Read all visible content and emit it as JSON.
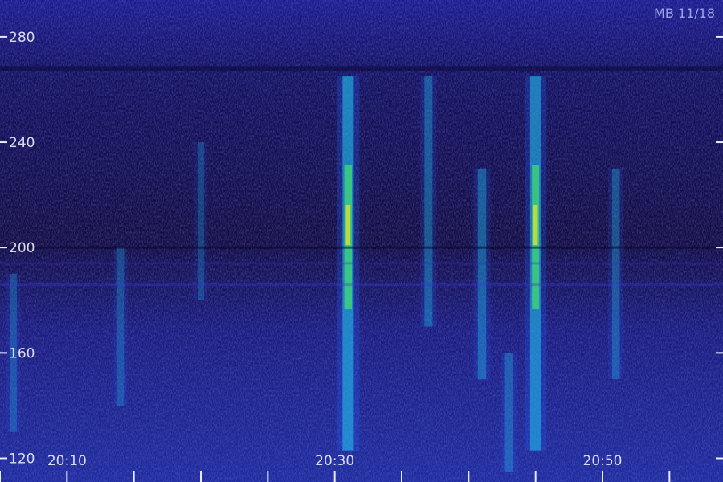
{
  "chart_data": {
    "type": "heatmap",
    "title": "",
    "xlabel": "",
    "ylabel": "",
    "watermark": "MB 11/18",
    "y_ticks": [
      {
        "value": 280,
        "label": "280"
      },
      {
        "value": 240,
        "label": "240"
      },
      {
        "value": 200,
        "label": "200"
      },
      {
        "value": 160,
        "label": "160"
      },
      {
        "value": 120,
        "label": "120"
      }
    ],
    "x_tick_labels": [
      {
        "value": "20:10",
        "label": "20:10"
      },
      {
        "value": "20:30",
        "label": "20:30"
      },
      {
        "value": "20:50",
        "label": "20:50"
      }
    ],
    "x_range": [
      "20:05",
      "20:59"
    ],
    "y_range": [
      111,
      294
    ],
    "minor_x_ticks": [
      "20:05",
      "20:10",
      "20:15",
      "20:20",
      "20:25",
      "20:30",
      "20:35",
      "20:40",
      "20:45",
      "20:50",
      "20:55"
    ],
    "vertical_streaks": [
      {
        "time": "20:31",
        "freq_range": [
          123,
          265
        ],
        "intensity": 1.0
      },
      {
        "time": "20:45",
        "freq_range": [
          123,
          265
        ],
        "intensity": 0.95
      },
      {
        "time": "20:41",
        "freq_range": [
          150,
          230
        ],
        "intensity": 0.65
      },
      {
        "time": "20:37",
        "freq_range": [
          170,
          265
        ],
        "intensity": 0.6
      },
      {
        "time": "20:51",
        "freq_range": [
          150,
          230
        ],
        "intensity": 0.55
      },
      {
        "time": "20:20",
        "freq_range": [
          180,
          240
        ],
        "intensity": 0.4
      },
      {
        "time": "20:14",
        "freq_range": [
          140,
          200
        ],
        "intensity": 0.45
      },
      {
        "time": "20:06",
        "freq_range": [
          130,
          190
        ],
        "intensity": 0.45
      },
      {
        "time": "20:43",
        "freq_range": [
          115,
          160
        ],
        "intensity": 0.55
      }
    ],
    "colormap": [
      "#1a0f4a",
      "#2a22b8",
      "#2266ff",
      "#22c8e8",
      "#44e070",
      "#e8e030"
    ],
    "grid": false
  }
}
